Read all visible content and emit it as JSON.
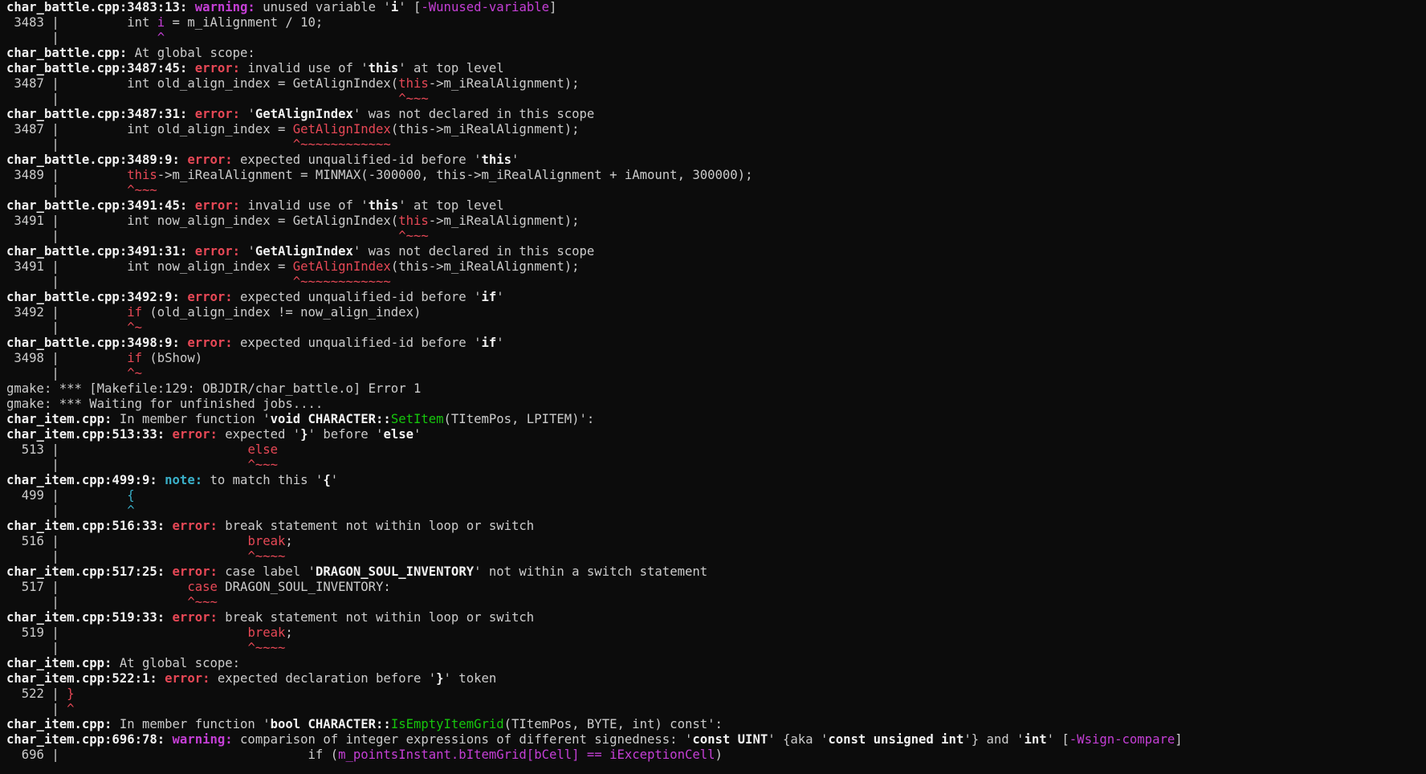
{
  "theme": {
    "background": "#0c0c0c",
    "foreground": "#cccccc",
    "bold": "#f2f2f2",
    "error": "#e74856",
    "warning": "#c53fd6",
    "note": "#3ab0c9",
    "green": "#16c60c"
  },
  "lines": [
    {
      "segs": [
        {
          "t": "char_battle.cpp:3483:13: ",
          "c": "bold"
        },
        {
          "t": "warning: ",
          "c": "warning"
        },
        {
          "t": "unused variable '",
          "c": "plain"
        },
        {
          "t": "i",
          "c": "bold"
        },
        {
          "t": "' [",
          "c": "plain"
        },
        {
          "t": "-Wunused-variable",
          "c": "magenta"
        },
        {
          "t": "]",
          "c": "plain"
        }
      ]
    },
    {
      "segs": [
        {
          "t": " 3483 |         int ",
          "c": "plain"
        },
        {
          "t": "i",
          "c": "magenta"
        },
        {
          "t": " = m_iAlignment / 10;",
          "c": "plain"
        }
      ]
    },
    {
      "segs": [
        {
          "t": "      |             ",
          "c": "plain"
        },
        {
          "t": "^",
          "c": "magenta"
        }
      ]
    },
    {
      "segs": [
        {
          "t": "char_battle.cpp:",
          "c": "bold"
        },
        {
          "t": " At global scope:",
          "c": "plain"
        }
      ]
    },
    {
      "segs": [
        {
          "t": "char_battle.cpp:3487:45: ",
          "c": "bold"
        },
        {
          "t": "error: ",
          "c": "error"
        },
        {
          "t": "invalid use of '",
          "c": "plain"
        },
        {
          "t": "this",
          "c": "bold"
        },
        {
          "t": "' at top level",
          "c": "plain"
        }
      ]
    },
    {
      "segs": [
        {
          "t": " 3487 |         int old_align_index = GetAlignIndex(",
          "c": "plain"
        },
        {
          "t": "this",
          "c": "red"
        },
        {
          "t": "->m_iRealAlignment);",
          "c": "plain"
        }
      ]
    },
    {
      "segs": [
        {
          "t": "      |                                             ",
          "c": "plain"
        },
        {
          "t": "^~~~",
          "c": "red"
        }
      ]
    },
    {
      "segs": [
        {
          "t": "char_battle.cpp:3487:31: ",
          "c": "bold"
        },
        {
          "t": "error: ",
          "c": "error"
        },
        {
          "t": "'",
          "c": "plain"
        },
        {
          "t": "GetAlignIndex",
          "c": "bold"
        },
        {
          "t": "' was not declared in this scope",
          "c": "plain"
        }
      ]
    },
    {
      "segs": [
        {
          "t": " 3487 |         int old_align_index = ",
          "c": "plain"
        },
        {
          "t": "GetAlignIndex",
          "c": "red"
        },
        {
          "t": "(this->m_iRealAlignment);",
          "c": "plain"
        }
      ]
    },
    {
      "segs": [
        {
          "t": "      |                               ",
          "c": "plain"
        },
        {
          "t": "^~~~~~~~~~~~~",
          "c": "red"
        }
      ]
    },
    {
      "segs": [
        {
          "t": "char_battle.cpp:3489:9: ",
          "c": "bold"
        },
        {
          "t": "error: ",
          "c": "error"
        },
        {
          "t": "expected unqualified-id before '",
          "c": "plain"
        },
        {
          "t": "this",
          "c": "bold"
        },
        {
          "t": "'",
          "c": "plain"
        }
      ]
    },
    {
      "segs": [
        {
          "t": " 3489 |         ",
          "c": "plain"
        },
        {
          "t": "this",
          "c": "red"
        },
        {
          "t": "->m_iRealAlignment = MINMAX(-300000, this->m_iRealAlignment + iAmount, 300000);",
          "c": "plain"
        }
      ]
    },
    {
      "segs": [
        {
          "t": "      |         ",
          "c": "plain"
        },
        {
          "t": "^~~~",
          "c": "red"
        }
      ]
    },
    {
      "segs": [
        {
          "t": "char_battle.cpp:3491:45: ",
          "c": "bold"
        },
        {
          "t": "error: ",
          "c": "error"
        },
        {
          "t": "invalid use of '",
          "c": "plain"
        },
        {
          "t": "this",
          "c": "bold"
        },
        {
          "t": "' at top level",
          "c": "plain"
        }
      ]
    },
    {
      "segs": [
        {
          "t": " 3491 |         int now_align_index = GetAlignIndex(",
          "c": "plain"
        },
        {
          "t": "this",
          "c": "red"
        },
        {
          "t": "->m_iRealAlignment);",
          "c": "plain"
        }
      ]
    },
    {
      "segs": [
        {
          "t": "      |                                             ",
          "c": "plain"
        },
        {
          "t": "^~~~",
          "c": "red"
        }
      ]
    },
    {
      "segs": [
        {
          "t": "char_battle.cpp:3491:31: ",
          "c": "bold"
        },
        {
          "t": "error: ",
          "c": "error"
        },
        {
          "t": "'",
          "c": "plain"
        },
        {
          "t": "GetAlignIndex",
          "c": "bold"
        },
        {
          "t": "' was not declared in this scope",
          "c": "plain"
        }
      ]
    },
    {
      "segs": [
        {
          "t": " 3491 |         int now_align_index = ",
          "c": "plain"
        },
        {
          "t": "GetAlignIndex",
          "c": "red"
        },
        {
          "t": "(this->m_iRealAlignment);",
          "c": "plain"
        }
      ]
    },
    {
      "segs": [
        {
          "t": "      |                               ",
          "c": "plain"
        },
        {
          "t": "^~~~~~~~~~~~~",
          "c": "red"
        }
      ]
    },
    {
      "segs": [
        {
          "t": "char_battle.cpp:3492:9: ",
          "c": "bold"
        },
        {
          "t": "error: ",
          "c": "error"
        },
        {
          "t": "expected unqualified-id before '",
          "c": "plain"
        },
        {
          "t": "if",
          "c": "bold"
        },
        {
          "t": "'",
          "c": "plain"
        }
      ]
    },
    {
      "segs": [
        {
          "t": " 3492 |         ",
          "c": "plain"
        },
        {
          "t": "if",
          "c": "red"
        },
        {
          "t": " (old_align_index != now_align_index)",
          "c": "plain"
        }
      ]
    },
    {
      "segs": [
        {
          "t": "      |         ",
          "c": "plain"
        },
        {
          "t": "^~",
          "c": "red"
        }
      ]
    },
    {
      "segs": [
        {
          "t": "char_battle.cpp:3498:9: ",
          "c": "bold"
        },
        {
          "t": "error: ",
          "c": "error"
        },
        {
          "t": "expected unqualified-id before '",
          "c": "plain"
        },
        {
          "t": "if",
          "c": "bold"
        },
        {
          "t": "'",
          "c": "plain"
        }
      ]
    },
    {
      "segs": [
        {
          "t": " 3498 |         ",
          "c": "plain"
        },
        {
          "t": "if",
          "c": "red"
        },
        {
          "t": " (bShow)",
          "c": "plain"
        }
      ]
    },
    {
      "segs": [
        {
          "t": "      |         ",
          "c": "plain"
        },
        {
          "t": "^~",
          "c": "red"
        }
      ]
    },
    {
      "segs": [
        {
          "t": "gmake: *** [Makefile:129: OBJDIR/char_battle.o] Error 1",
          "c": "plain"
        }
      ]
    },
    {
      "segs": [
        {
          "t": "gmake: *** Waiting for unfinished jobs....",
          "c": "plain"
        }
      ]
    },
    {
      "segs": [
        {
          "t": "char_item.cpp:",
          "c": "bold"
        },
        {
          "t": " In member function '",
          "c": "plain"
        },
        {
          "t": "void CHARACTER::",
          "c": "bold"
        },
        {
          "t": "SetItem",
          "c": "green"
        },
        {
          "t": "(TItemPos, LPITEM)",
          "c": "plain"
        },
        {
          "t": "':",
          "c": "plain"
        }
      ]
    },
    {
      "segs": [
        {
          "t": "char_item.cpp:513:33: ",
          "c": "bold"
        },
        {
          "t": "error: ",
          "c": "error"
        },
        {
          "t": "expected '",
          "c": "plain"
        },
        {
          "t": "}",
          "c": "bold"
        },
        {
          "t": "' before '",
          "c": "plain"
        },
        {
          "t": "else",
          "c": "bold"
        },
        {
          "t": "'",
          "c": "plain"
        }
      ]
    },
    {
      "segs": [
        {
          "t": "  513 |                         ",
          "c": "plain"
        },
        {
          "t": "else",
          "c": "red"
        }
      ]
    },
    {
      "segs": [
        {
          "t": "      |                         ",
          "c": "plain"
        },
        {
          "t": "^~~~",
          "c": "red"
        }
      ]
    },
    {
      "segs": [
        {
          "t": "char_item.cpp:499:9: ",
          "c": "bold"
        },
        {
          "t": "note: ",
          "c": "note"
        },
        {
          "t": "to match this '",
          "c": "plain"
        },
        {
          "t": "{",
          "c": "bold"
        },
        {
          "t": "'",
          "c": "plain"
        }
      ]
    },
    {
      "segs": [
        {
          "t": "  499 |         ",
          "c": "plain"
        },
        {
          "t": "{",
          "c": "cyan"
        }
      ]
    },
    {
      "segs": [
        {
          "t": "      |         ",
          "c": "plain"
        },
        {
          "t": "^",
          "c": "cyan"
        }
      ]
    },
    {
      "segs": [
        {
          "t": "char_item.cpp:516:33: ",
          "c": "bold"
        },
        {
          "t": "error: ",
          "c": "error"
        },
        {
          "t": "break statement not within loop or switch",
          "c": "plain"
        }
      ]
    },
    {
      "segs": [
        {
          "t": "  516 |                         ",
          "c": "plain"
        },
        {
          "t": "break",
          "c": "red"
        },
        {
          "t": ";",
          "c": "plain"
        }
      ]
    },
    {
      "segs": [
        {
          "t": "      |                         ",
          "c": "plain"
        },
        {
          "t": "^~~~~",
          "c": "red"
        }
      ]
    },
    {
      "segs": [
        {
          "t": "char_item.cpp:517:25: ",
          "c": "bold"
        },
        {
          "t": "error: ",
          "c": "error"
        },
        {
          "t": "case label '",
          "c": "plain"
        },
        {
          "t": "DRAGON_SOUL_INVENTORY",
          "c": "bold"
        },
        {
          "t": "' not within a switch statement",
          "c": "plain"
        }
      ]
    },
    {
      "segs": [
        {
          "t": "  517 |                 ",
          "c": "plain"
        },
        {
          "t": "case",
          "c": "red"
        },
        {
          "t": " DRAGON_SOUL_INVENTORY:",
          "c": "plain"
        }
      ]
    },
    {
      "segs": [
        {
          "t": "      |                 ",
          "c": "plain"
        },
        {
          "t": "^~~~",
          "c": "red"
        }
      ]
    },
    {
      "segs": [
        {
          "t": "char_item.cpp:519:33: ",
          "c": "bold"
        },
        {
          "t": "error: ",
          "c": "error"
        },
        {
          "t": "break statement not within loop or switch",
          "c": "plain"
        }
      ]
    },
    {
      "segs": [
        {
          "t": "  519 |                         ",
          "c": "plain"
        },
        {
          "t": "break",
          "c": "red"
        },
        {
          "t": ";",
          "c": "plain"
        }
      ]
    },
    {
      "segs": [
        {
          "t": "      |                         ",
          "c": "plain"
        },
        {
          "t": "^~~~~",
          "c": "red"
        }
      ]
    },
    {
      "segs": [
        {
          "t": "char_item.cpp:",
          "c": "bold"
        },
        {
          "t": " At global scope:",
          "c": "plain"
        }
      ]
    },
    {
      "segs": [
        {
          "t": "char_item.cpp:522:1: ",
          "c": "bold"
        },
        {
          "t": "error: ",
          "c": "error"
        },
        {
          "t": "expected declaration before '",
          "c": "plain"
        },
        {
          "t": "}",
          "c": "bold"
        },
        {
          "t": "' token",
          "c": "plain"
        }
      ]
    },
    {
      "segs": [
        {
          "t": "  522 | ",
          "c": "plain"
        },
        {
          "t": "}",
          "c": "red"
        }
      ]
    },
    {
      "segs": [
        {
          "t": "      | ",
          "c": "plain"
        },
        {
          "t": "^",
          "c": "red"
        }
      ]
    },
    {
      "segs": [
        {
          "t": "char_item.cpp:",
          "c": "bold"
        },
        {
          "t": " In member function '",
          "c": "plain"
        },
        {
          "t": "bool CHARACTER::",
          "c": "bold"
        },
        {
          "t": "IsEmptyItemGrid",
          "c": "green"
        },
        {
          "t": "(TItemPos, BYTE, int) const",
          "c": "plain"
        },
        {
          "t": "':",
          "c": "plain"
        }
      ]
    },
    {
      "segs": [
        {
          "t": "char_item.cpp:696:78: ",
          "c": "bold"
        },
        {
          "t": "warning: ",
          "c": "warning"
        },
        {
          "t": "comparison of integer expressions of different signedness: '",
          "c": "plain"
        },
        {
          "t": "const UINT",
          "c": "bold"
        },
        {
          "t": "' {aka '",
          "c": "plain"
        },
        {
          "t": "const unsigned int",
          "c": "bold"
        },
        {
          "t": "'} and '",
          "c": "plain"
        },
        {
          "t": "int",
          "c": "bold"
        },
        {
          "t": "' [",
          "c": "plain"
        },
        {
          "t": "-Wsign-compare",
          "c": "magenta"
        },
        {
          "t": "]",
          "c": "plain"
        }
      ]
    },
    {
      "segs": [
        {
          "t": "  696 |                                 if (",
          "c": "plain"
        },
        {
          "t": "m_pointsInstant.bItemGrid[bCell] == iExceptionCell",
          "c": "magenta"
        },
        {
          "t": ")",
          "c": "plain"
        }
      ]
    }
  ]
}
